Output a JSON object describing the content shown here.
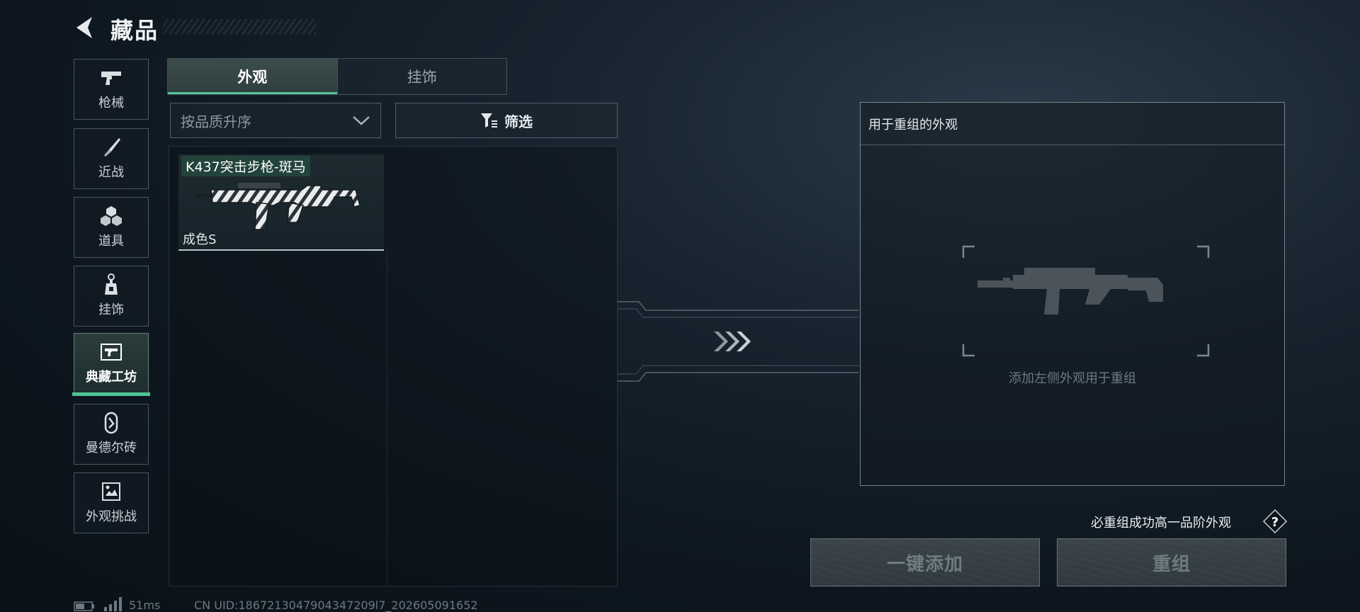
{
  "header": {
    "title": "藏品",
    "back_icon": "back-arrow-icon"
  },
  "sidebar": {
    "items": [
      {
        "label": "枪械",
        "icon": "pistol-icon"
      },
      {
        "label": "近战",
        "icon": "knife-icon"
      },
      {
        "label": "道具",
        "icon": "grenade-cluster-icon"
      },
      {
        "label": "挂饰",
        "icon": "keychain-icon"
      },
      {
        "label": "典藏工坊",
        "icon": "workshop-gun-icon",
        "active": true
      },
      {
        "label": "曼德尔砖",
        "icon": "mandel-brick-icon"
      },
      {
        "label": "外观挑战",
        "icon": "challenge-image-icon"
      }
    ],
    "accent_color": "#4fc394"
  },
  "tabs": [
    {
      "label": "外观",
      "active": true
    },
    {
      "label": "挂饰",
      "active": false
    }
  ],
  "sort": {
    "label": "按品质升序",
    "icon": "chevron-down-icon"
  },
  "filter": {
    "label": "筛选",
    "icon": "filter-icon"
  },
  "items": [
    {
      "name": "K437突击步枪-斑马",
      "grade": "成色S",
      "image": "zebra-rifle-image"
    }
  ],
  "recombine": {
    "title": "用于重组的外观",
    "hint": "添加左侧外观用于重组",
    "placeholder_icon": "rifle-silhouette-icon"
  },
  "guarantee": {
    "text": "必重组成功高一品阶外观",
    "help_icon": "question-icon"
  },
  "buttons": {
    "add_all": "一键添加",
    "recombine": "重组"
  },
  "status": {
    "ping": "51ms",
    "uid": "CN UID:1867213047904347209l7_202605091652"
  }
}
